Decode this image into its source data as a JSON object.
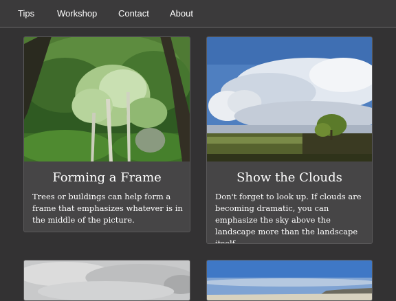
{
  "nav": {
    "items": [
      {
        "label": "Tips"
      },
      {
        "label": "Workshop"
      },
      {
        "label": "Contact"
      },
      {
        "label": "About"
      }
    ]
  },
  "cards": [
    {
      "title": "Forming a Frame",
      "text": "Trees or buildings can help form a frame that emphasizes whatever is in the middle of the picture.",
      "image": "forest-frame-photo"
    },
    {
      "title": "Show the Clouds",
      "text": "Don't forget to look up. If clouds are becoming dramatic, you can emphasize the sky above the landscape more than the landscape itself.",
      "image": "cloudy-sky-landscape-photo"
    },
    {
      "title": "",
      "text": "",
      "image": "overcast-sky-photo"
    },
    {
      "title": "",
      "text": "",
      "image": "blue-sky-mountain-photo"
    }
  ],
  "colors": {
    "page_bg": "#333233",
    "nav_bg": "#3b3a3b",
    "card_bg": "#464546",
    "text": "#ffffff"
  }
}
